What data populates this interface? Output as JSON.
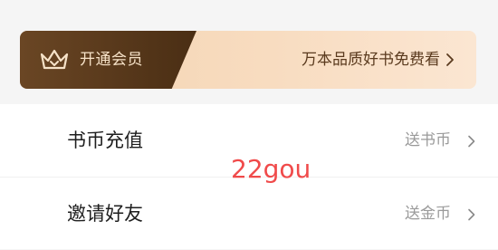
{
  "vip_banner": {
    "title": "开通会员",
    "promo": "万本品质好书免费看",
    "crown_icon": "crown-icon",
    "chevron_icon": "chevron-right-icon",
    "colors": {
      "left_panel": "#4a2e14",
      "title_text": "#f6e2c8",
      "right_panel": "#f8dcc0",
      "promo_text": "#5a3a1e"
    }
  },
  "menu": {
    "items": [
      {
        "label": "书币充值",
        "hint": "送书币",
        "icon": "chevron-right-icon"
      },
      {
        "label": "邀请好友",
        "hint": "送金币",
        "icon": "chevron-right-icon"
      }
    ]
  },
  "watermark": "22gou"
}
